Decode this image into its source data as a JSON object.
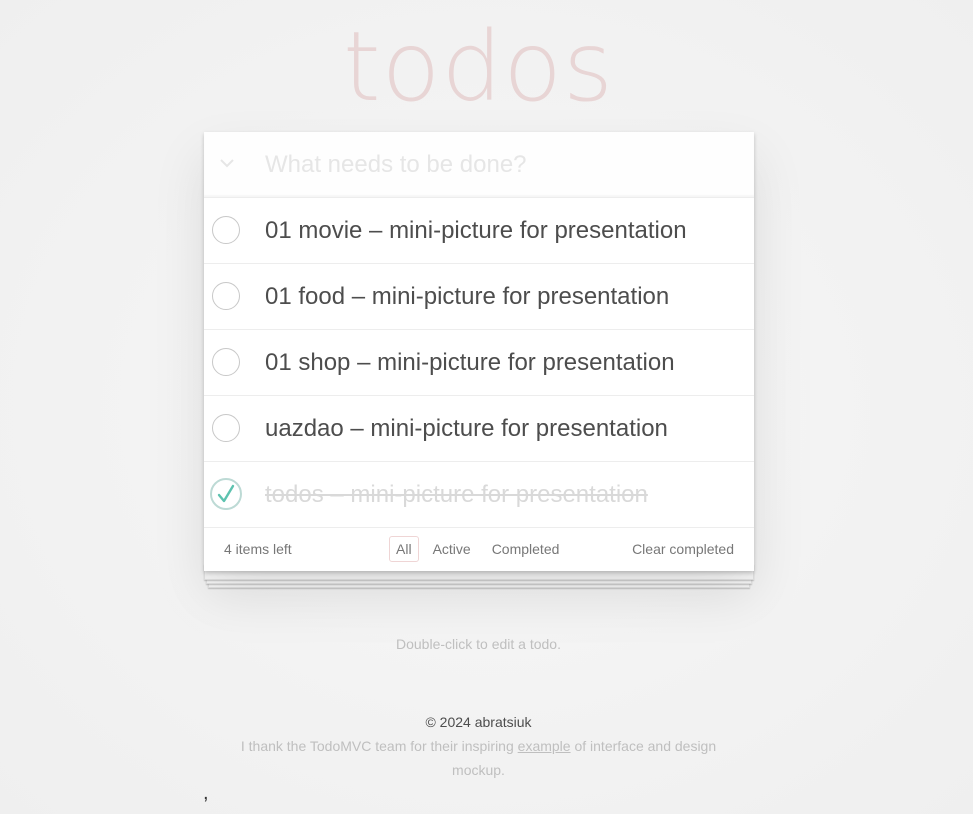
{
  "app": {
    "title": "todos"
  },
  "new_todo": {
    "placeholder": "What needs to be done?",
    "toggle_all_icon": "chevron-down-icon"
  },
  "todos": [
    {
      "label": "01 movie – mini-picture for presentation",
      "completed": false
    },
    {
      "label": "01 food – mini-picture for presentation",
      "completed": false
    },
    {
      "label": "01 shop – mini-picture for presentation",
      "completed": false
    },
    {
      "label": "uazdao – mini-picture for presentation",
      "completed": false
    },
    {
      "label": "todos – mini-picture for presentation",
      "completed": true
    }
  ],
  "footer": {
    "count": "4 items left",
    "filters": [
      "All",
      "Active",
      "Completed"
    ],
    "selected_filter": "All",
    "clear_label": "Clear completed"
  },
  "info": {
    "hint": "Double-click to edit a todo.",
    "owner": "© 2024 abratsiuk",
    "thanks_before": "I thank the TodoMVC team for their inspiring ",
    "thanks_link": "example",
    "thanks_after": " of interface and design mockup.",
    "stray_mark": ","
  },
  "colors": {
    "title": "#eaD5D5",
    "check": "#5dc2af",
    "filter_border": "#efd5d5"
  }
}
